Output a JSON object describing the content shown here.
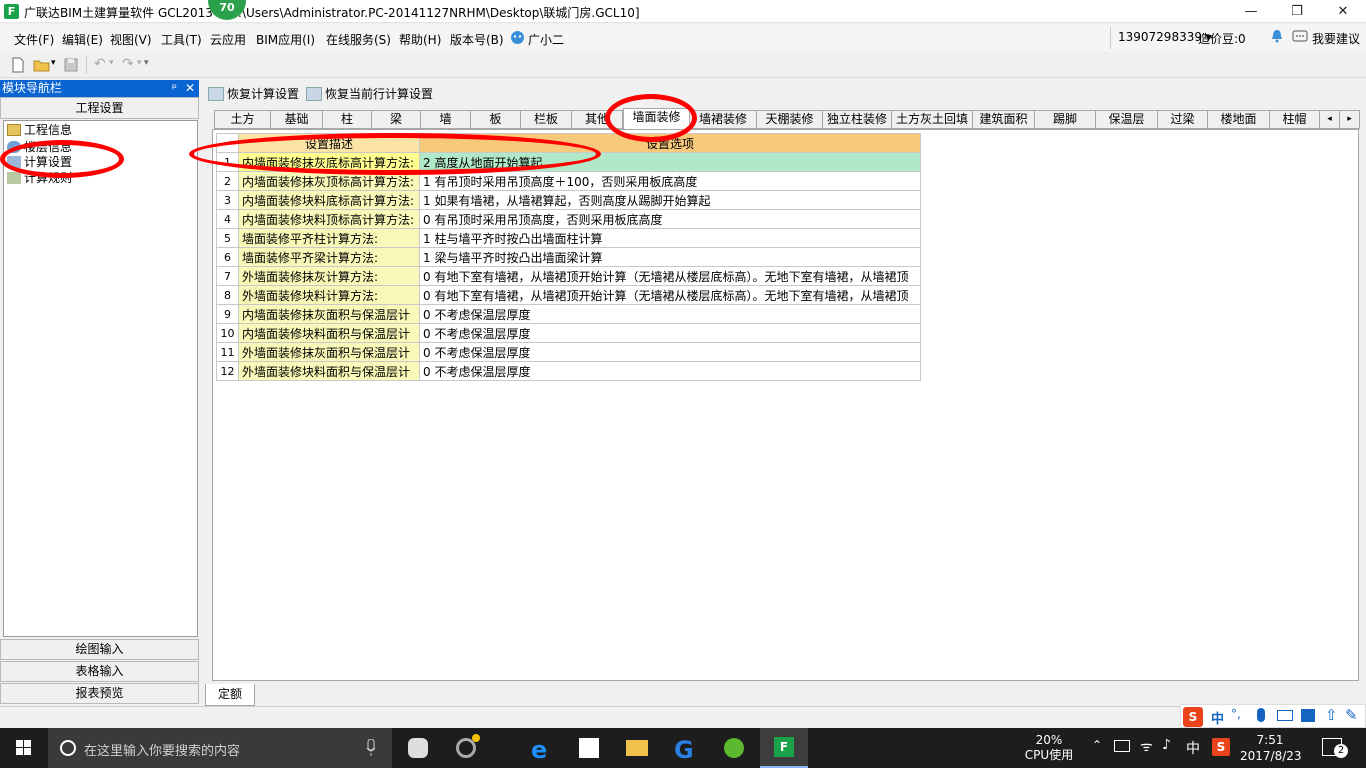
{
  "window": {
    "title": "广联达BIM土建算量软件 GCL2013 - [C:\\Users\\Administrator.PC-20141127NRHM\\Desktop\\联城门房.GCL10]",
    "badge": "70",
    "minimize": "—",
    "maximize": "❐",
    "close": "✕"
  },
  "menu": {
    "items": [
      "文件(F)",
      "编辑(E)",
      "视图(V)",
      "工具(T)",
      "云应用",
      "BIM应用(I)",
      "在线服务(S)",
      "帮助(H)",
      "版本号(B)",
      "广小二"
    ],
    "phone": "13907298339",
    "coins": "造价豆:0",
    "suggest": "我要建议"
  },
  "nav": {
    "title": "模块导航栏",
    "pin": "ᵖ",
    "close": "✕",
    "section": "工程设置",
    "tree": [
      "工程信息",
      "楼层信息",
      "计算设置",
      "计算规则"
    ],
    "bottom": [
      "绘图输入",
      "表格输入",
      "报表预览"
    ]
  },
  "toolbar2": {
    "restore_all": "恢复计算设置",
    "restore_row": "恢复当前行计算设置"
  },
  "tabs": [
    "土方",
    "基础",
    "柱",
    "梁",
    "墙",
    "板",
    "栏板",
    "其他",
    "墙面装修",
    "墙裙装修",
    "天棚装修",
    "独立柱装修",
    "土方灰土回填",
    "建筑面积",
    "踢脚",
    "保温层",
    "过梁",
    "楼地面",
    "柱帽"
  ],
  "active_tab": "墙面装修",
  "grid": {
    "header_desc": "设置描述",
    "header_val": "设置选项",
    "rows": [
      {
        "n": "1",
        "desc": "内墙面装修抹灰底标高计算方法:",
        "val": "2 高度从地面开始算起"
      },
      {
        "n": "2",
        "desc": "内墙面装修抹灰顶标高计算方法:",
        "val": "1 有吊顶时采用吊顶高度＋100，否则采用板底高度"
      },
      {
        "n": "3",
        "desc": "内墙面装修块料底标高计算方法:",
        "val": "1 如果有墙裙，从墙裙算起，否则高度从踢脚开始算起"
      },
      {
        "n": "4",
        "desc": "内墙面装修块料顶标高计算方法:",
        "val": "0 有吊顶时采用吊顶高度，否则采用板底高度"
      },
      {
        "n": "5",
        "desc": "墙面装修平齐柱计算方法:",
        "val": "1 柱与墙平齐时按凸出墙面柱计算"
      },
      {
        "n": "6",
        "desc": "墙面装修平齐梁计算方法:",
        "val": "1 梁与墙平齐时按凸出墙面梁计算"
      },
      {
        "n": "7",
        "desc": "外墙面装修抹灰计算方法:",
        "val": "0 有地下室有墙裙，从墙裙顶开始计算（无墙裙从楼层底标高）。无地下室有墙裙，从墙裙顶"
      },
      {
        "n": "8",
        "desc": "外墙面装修块料计算方法:",
        "val": "0 有地下室有墙裙，从墙裙顶开始计算（无墙裙从楼层底标高）。无地下室有墙裙，从墙裙顶"
      },
      {
        "n": "9",
        "desc": "内墙面装修抹灰面积与保温层计",
        "val": "0 不考虑保温层厚度"
      },
      {
        "n": "10",
        "desc": "内墙面装修块料面积与保温层计",
        "val": "0 不考虑保温层厚度"
      },
      {
        "n": "11",
        "desc": "外墙面装修抹灰面积与保温层计",
        "val": "0 不考虑保温层厚度"
      },
      {
        "n": "12",
        "desc": "外墙面装修块料面积与保温层计",
        "val": "0 不考虑保温层厚度"
      }
    ]
  },
  "bottom_tab": "定额",
  "ime": {
    "lang": "中"
  },
  "taskbar": {
    "search_placeholder": "在这里输入你要搜索的内容",
    "cpu_percent": "20%",
    "cpu_label": "CPU使用",
    "ime_lang": "中",
    "time": "7:51",
    "date": "2017/8/23",
    "notifications": "2"
  },
  "colors": {
    "accent": "#0a64d2",
    "annotation": "#ff0000",
    "header": "#f7c97a",
    "selected_row": "#b0e8c8"
  }
}
